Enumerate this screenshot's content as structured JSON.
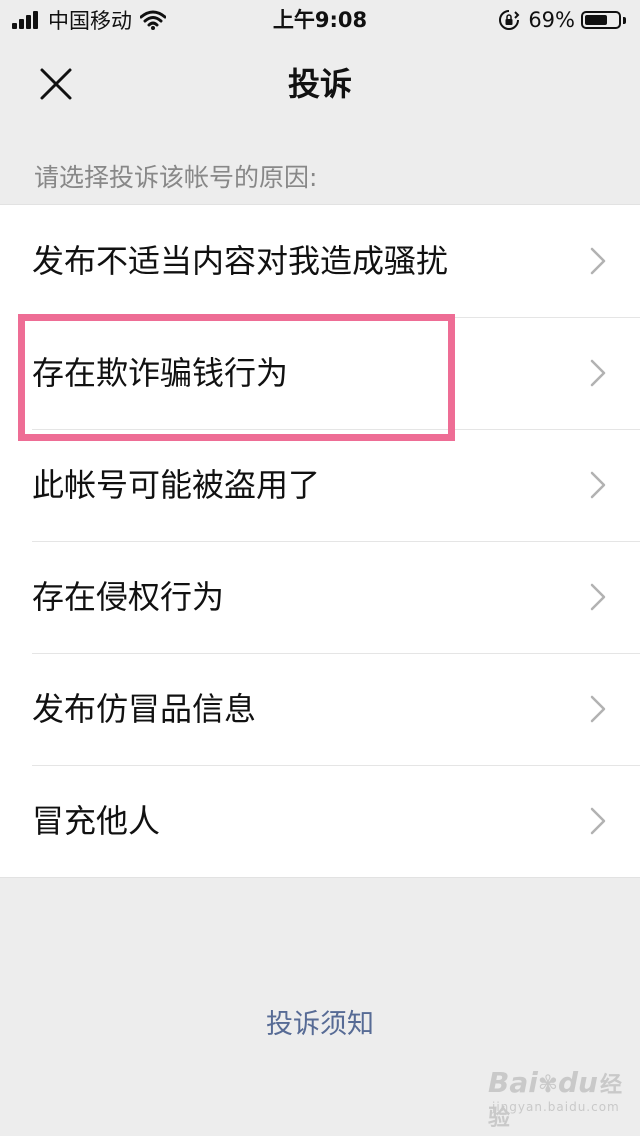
{
  "status_bar": {
    "carrier": "中国移动",
    "time": "上午9:08",
    "battery_percent": "69%",
    "battery_level": 0.69,
    "signal_icon": "signal-bars-icon",
    "wifi_icon": "wifi-icon",
    "rotation_lock_icon": "rotation-lock-icon"
  },
  "nav": {
    "title": "投诉",
    "close_icon": "close-icon"
  },
  "hint": "请选择投诉该帐号的原因:",
  "reasons": [
    {
      "label": "发布不适当内容对我造成骚扰"
    },
    {
      "label": "存在欺诈骗钱行为"
    },
    {
      "label": "此帐号可能被盗用了"
    },
    {
      "label": "存在侵权行为"
    },
    {
      "label": "发布仿冒品信息"
    },
    {
      "label": "冒充他人"
    }
  ],
  "footer": {
    "notice_link": "投诉须知"
  },
  "watermark": {
    "brand": "Bai",
    "brand_suffix": "du",
    "cn": "经验",
    "domain": "jingyan.baidu.com"
  },
  "colors": {
    "background": "#ededed",
    "list_background": "#ffffff",
    "link": "#576b95",
    "highlight": "#ee6d95",
    "hint_text": "#888888"
  }
}
